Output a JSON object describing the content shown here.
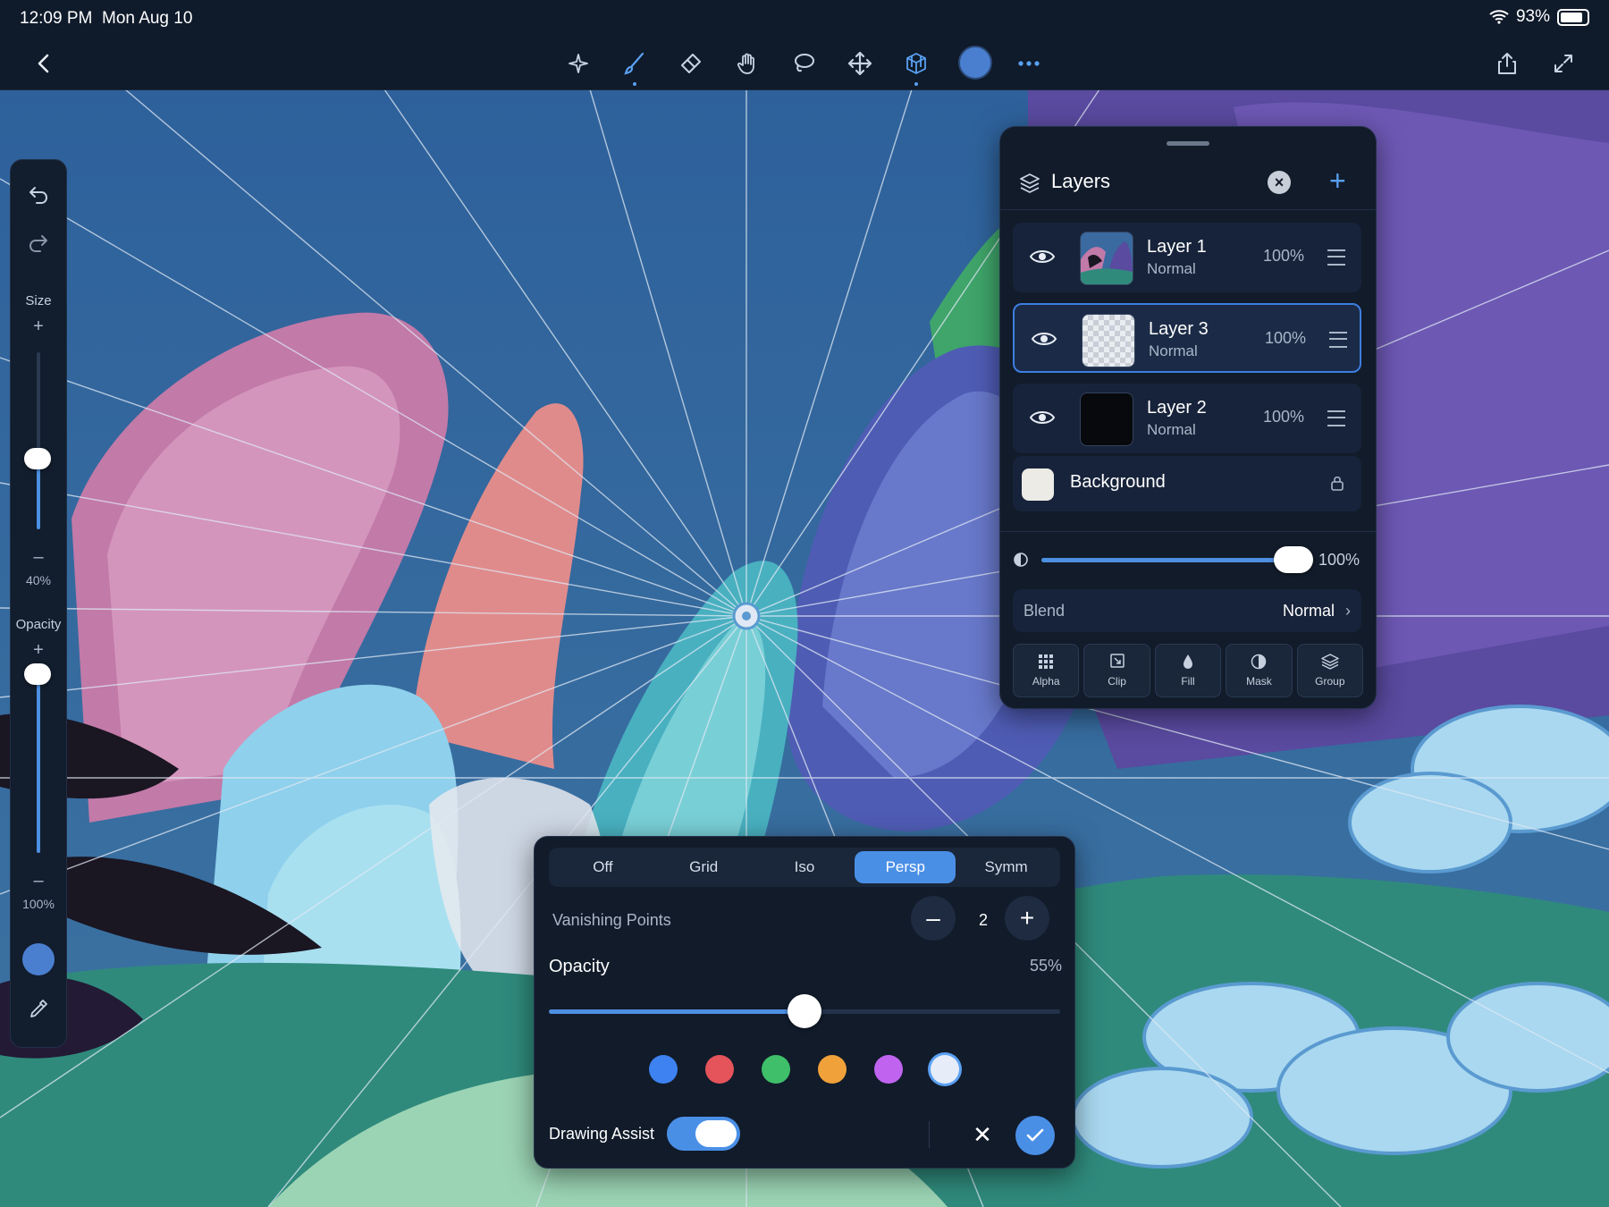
{
  "status_bar": {
    "time": "12:09 PM",
    "date": "Mon Aug 10",
    "battery": "93%"
  },
  "toolbar": {
    "tools": [
      "sparkle-icon",
      "brush-icon",
      "eraser-icon",
      "smudge-icon",
      "lasso-icon",
      "move-icon",
      "drawing-guide-icon",
      "color-swatch",
      "more-icon"
    ],
    "active_tools": [
      "brush-icon",
      "drawing-guide-icon"
    ],
    "current_color": "#4a7fd0"
  },
  "left_sidebar": {
    "size_label": "Size",
    "size_value": "40%",
    "size_level": 0.4,
    "opacity_label": "Opacity",
    "opacity_value": "100%",
    "opacity_level": 1.0,
    "color": "#4a7fd0"
  },
  "layers_panel": {
    "title": "Layers",
    "layers": [
      {
        "name": "Layer 1",
        "blend": "Normal",
        "opacity": "100%",
        "visible": true,
        "selected": false
      },
      {
        "name": "Layer 3",
        "blend": "Normal",
        "opacity": "100%",
        "visible": true,
        "selected": true
      },
      {
        "name": "Layer 2",
        "blend": "Normal",
        "opacity": "100%",
        "visible": true,
        "selected": false
      }
    ],
    "background": {
      "name": "Background",
      "locked": true,
      "color": "#ecebe6"
    },
    "opacity_value": "100%",
    "opacity_level": 1.0,
    "blend_label": "Blend",
    "blend_value": "Normal",
    "actions": [
      "Alpha",
      "Clip",
      "Fill",
      "Mask",
      "Group"
    ]
  },
  "guides_panel": {
    "modes": [
      "Off",
      "Grid",
      "Iso",
      "Persp",
      "Symm"
    ],
    "active_mode": "Persp",
    "vanishing_points_label": "Vanishing Points",
    "vanishing_points_value": "2",
    "opacity_label": "Opacity",
    "opacity_value": "55%",
    "opacity_level": 0.5,
    "swatches": [
      "#3d82f0",
      "#e4545a",
      "#3fbf6a",
      "#f0a13a",
      "#c064f0",
      "#e6ecf8"
    ],
    "selected_swatch": 5,
    "drawing_assist_label": "Drawing Assist",
    "drawing_assist_on": true
  }
}
